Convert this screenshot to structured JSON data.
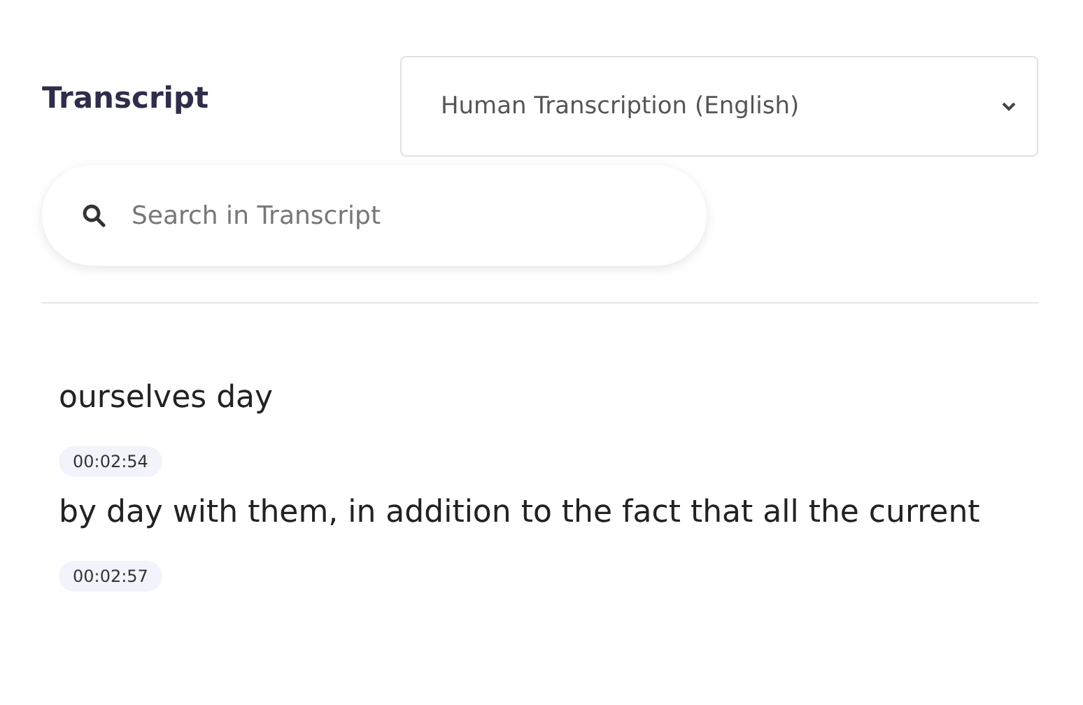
{
  "title": "Transcript",
  "transcription_select": {
    "value": "Human Transcription (English)"
  },
  "search": {
    "placeholder": "Search in Transcript"
  },
  "segments": [
    {
      "text": "ourselves day"
    },
    {
      "time": "00:02:54",
      "text": "by day with them, in addition to the fact that all the current"
    },
    {
      "time": "00:02:57"
    }
  ]
}
